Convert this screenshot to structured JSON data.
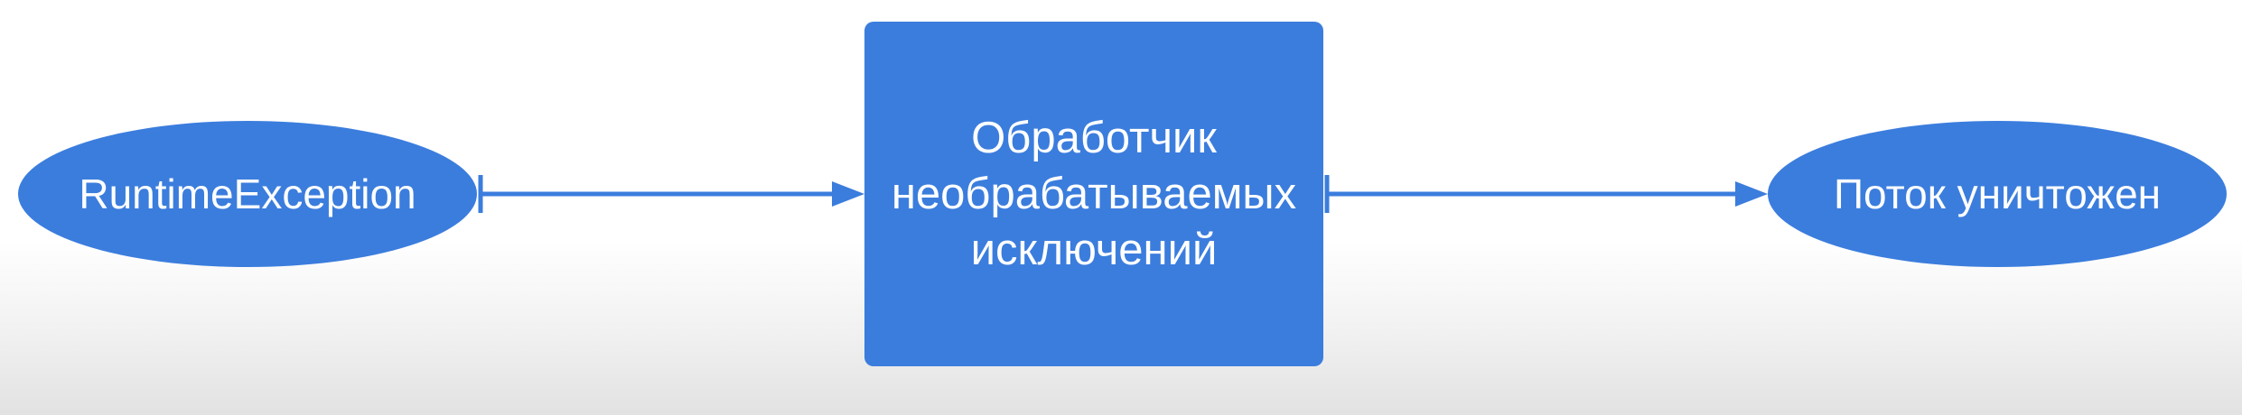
{
  "diagram": {
    "start_node": {
      "label": "RuntimeException",
      "shape": "oval"
    },
    "handler_node": {
      "label": "Обработчик\nнеобрабатываемых\nисключений",
      "shape": "rectangle"
    },
    "end_node": {
      "label": "Поток уничтожен",
      "shape": "oval"
    },
    "edges": [
      {
        "from": "RuntimeException",
        "to": "Обработчик необрабатываемых исключений"
      },
      {
        "from": "Обработчик необрабатываемых исключений",
        "to": "Поток уничтожен"
      }
    ],
    "colors": {
      "node_fill": "#3b7ddd",
      "node_text": "#ffffff",
      "edge": "#3b7ddd"
    }
  }
}
